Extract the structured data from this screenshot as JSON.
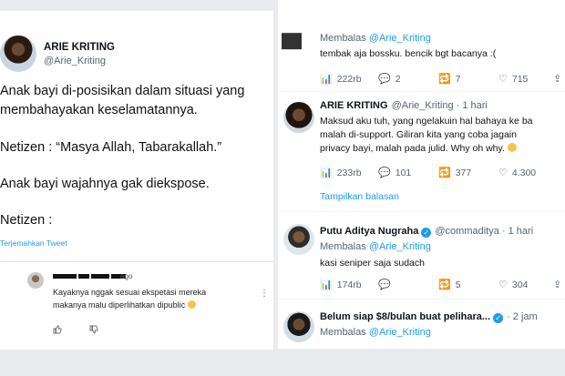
{
  "left_tweet": {
    "name": "ARIE KRITING",
    "handle": "@Arie_Kriting",
    "lines": [
      "Anak bayi di-posisikan dalam situasi yang",
      "membahayakan keselamatannya.",
      "Netizen : “Masya Allah, Tabarakallah.”",
      "Anak bayi wajahnya gak diekspose.",
      "Netizen :"
    ],
    "translate": "Terjemahkan Tweet"
  },
  "comment": {
    "ago": "ago",
    "lines": [
      "Kayaknya nggak sesuai ekspetasi mereka",
      "makanya malu diperlihatkan dipublic"
    ],
    "more": "⋮",
    "like_icon": "thumbs-up-icon",
    "dislike_icon": "thumbs-down-icon"
  },
  "right_thread": {
    "reply1": {
      "replying_prefix": "Membalas",
      "replying_to": "@Arie_Kriting",
      "text": "tembak aja bossku. bencik bgt bacanya :(",
      "views": "222rb",
      "replies": "2",
      "retweets": "7",
      "likes": "715"
    },
    "reply2": {
      "name": "ARIE KRITING",
      "handle": "@Arie_Kriting · 1 hari",
      "lines": [
        "Maksud aku tuh, yang ngelakuin hal bahaya ke ba",
        "malah di-support. Giliran kita yang coba jagain",
        "privacy bayi, malah pada julid. Why oh why."
      ],
      "views": "233rb",
      "replies": "101",
      "retweets": "377",
      "likes": "4.300",
      "show_replies": "Tampilkan balasan"
    },
    "reply3": {
      "name": "Putu Aditya Nugraha",
      "handle": "@commaditya · 1 hari",
      "replying_prefix": "Membalas",
      "replying_to": "@Arie_Kriting",
      "text": "kasi seniper saja sudach",
      "views": "174rb",
      "replies": "",
      "retweets": "5",
      "likes": "304"
    },
    "reply4": {
      "name": "Belum siap $8/bulan buat pelihara...",
      "handle": "· 2 jam",
      "replying_prefix": "Membalas",
      "replying_to": "@Arie_Kriting"
    }
  },
  "colors": {
    "accent": "#1d9bf0",
    "muted": "#536471"
  }
}
